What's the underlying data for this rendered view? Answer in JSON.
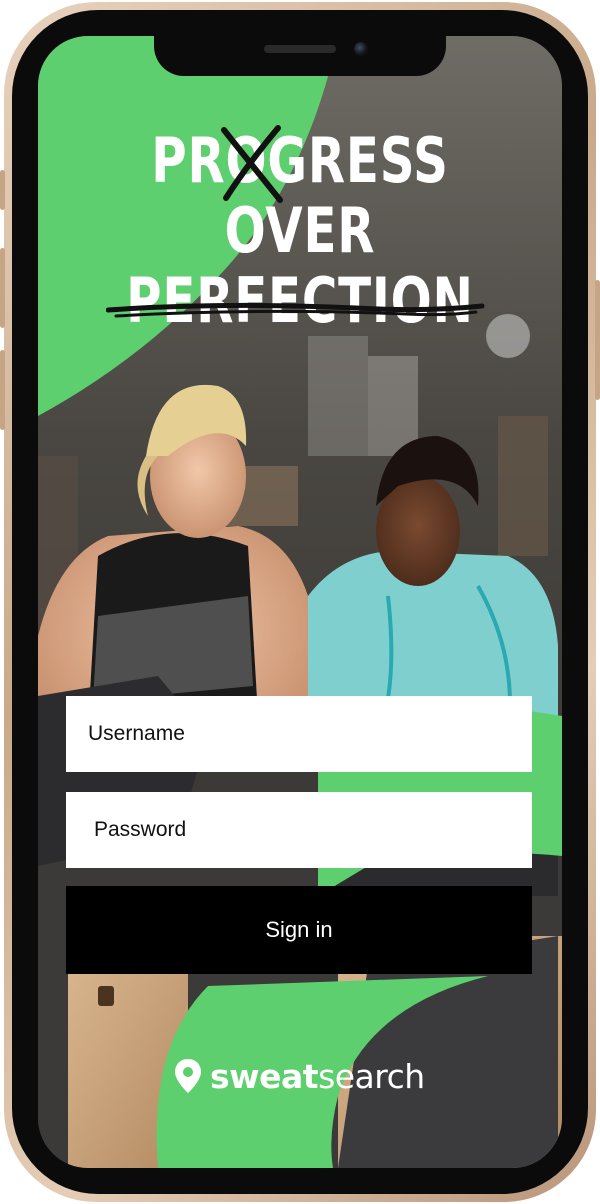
{
  "headline": {
    "line1_pre": "PR",
    "line1_struck": "O",
    "line1_post": "GRESS",
    "line2": "OVER",
    "line3": "PERFECTION"
  },
  "login": {
    "username_placeholder": "Username",
    "password_placeholder": "Password",
    "signin_label": "Sign in"
  },
  "brand": {
    "name_bold": "sweat",
    "name_regular": "search",
    "icon": "location-pin-icon",
    "accent_color": "#5ecf6e"
  }
}
